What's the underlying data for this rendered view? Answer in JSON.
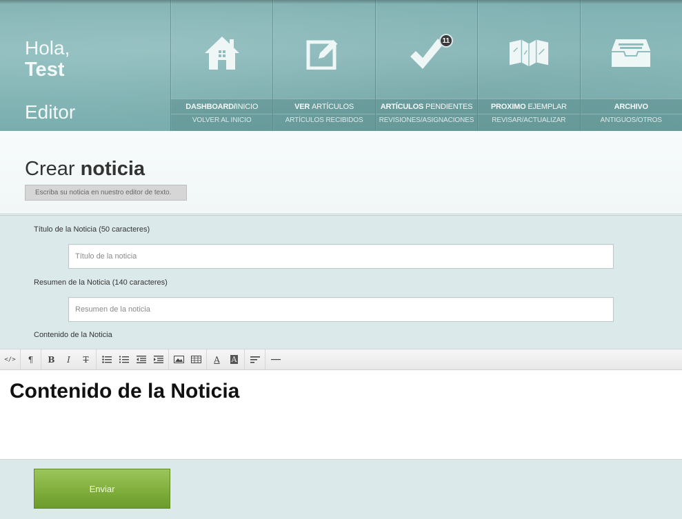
{
  "header": {
    "greeting": "Hola,",
    "user": "Test",
    "role": "Editor"
  },
  "nav": [
    {
      "label_bold": "DASHBOARD/",
      "label_rest": "INICIO",
      "sub_bold": "",
      "sub_rest": "VOLVER AL INICIO",
      "icon": "house-icon"
    },
    {
      "label_bold": "VER ",
      "label_rest": "ARTÍCULOS",
      "sub_bold": "ARTÍCULOS ",
      "sub_rest": "RECIBIDOS",
      "icon": "edit-icon"
    },
    {
      "label_bold": "ARTÍCULOS ",
      "label_rest": "PENDIENTES",
      "sub_bold": "REVISIONES/",
      "sub_rest": "ASIGNACIONES",
      "icon": "checkmark-icon",
      "badge": "11"
    },
    {
      "label_bold": "PROXIMO ",
      "label_rest": "EJEMPLAR",
      "sub_bold": "REVISAR/",
      "sub_rest": "ACTUALIZAR",
      "icon": "open-book-icon"
    },
    {
      "label_bold": "ARCHIVO",
      "label_rest": "",
      "sub_bold": "ANTIGUOS/",
      "sub_rest": "OTROS",
      "icon": "inbox-tray-icon"
    }
  ],
  "page": {
    "title_light": "Crear ",
    "title_bold": "noticia",
    "subtitle": "Escriba su noticia en nuestro editor de texto."
  },
  "form": {
    "title_label": "Título de la Noticia (50 caracteres)",
    "title_placeholder": "Título de la noticia",
    "summary_label": "Resumen de la Noticia (140 caracteres)",
    "summary_placeholder": "Resumen de la noticia",
    "content_label": "Contenido de la Noticia"
  },
  "editor": {
    "content": "Contenido de la Noticia",
    "toolbar": [
      "html-icon",
      "paragraph-icon",
      "bold-icon",
      "italic-icon",
      "strikethrough-icon",
      "unordered-list-icon",
      "ordered-list-icon",
      "outdent-icon",
      "indent-icon",
      "image-icon",
      "table-icon",
      "font-color-icon",
      "background-color-icon",
      "align-icon",
      "horizontal-rule-icon"
    ]
  },
  "actions": {
    "submit": "Enviar"
  },
  "colors": {
    "header": "#87b7b8",
    "background": "#dce9ea",
    "submit": "#86b243"
  }
}
